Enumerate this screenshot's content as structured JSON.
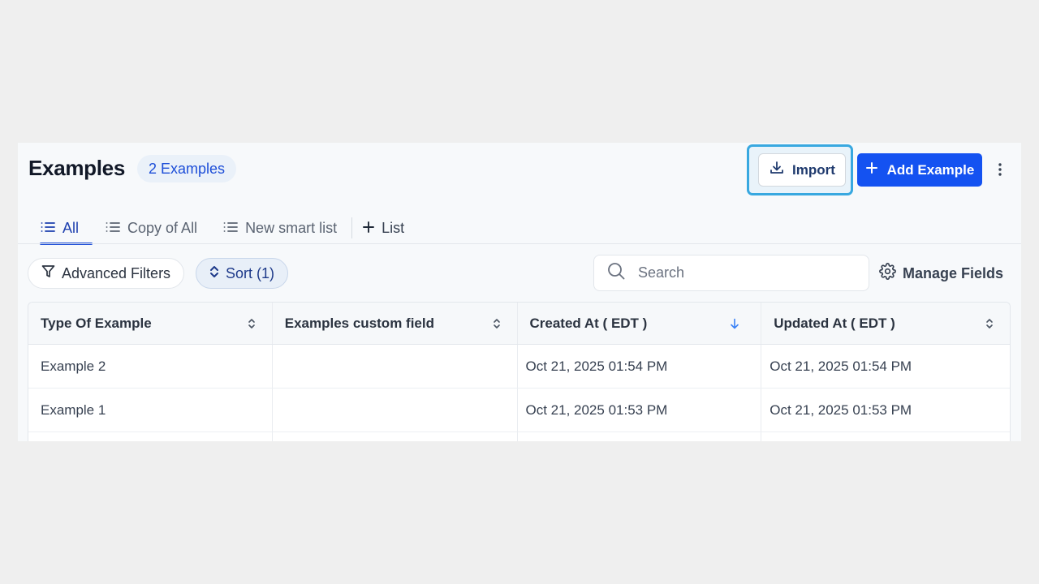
{
  "header": {
    "title": "Examples",
    "count_badge": "2 Examples",
    "import_label": "Import",
    "add_label": "Add Example"
  },
  "tabs": [
    {
      "label": "All",
      "active": true,
      "icon": "list-icon"
    },
    {
      "label": "Copy of All",
      "active": false,
      "icon": "list-icon"
    },
    {
      "label": "New smart list",
      "active": false,
      "icon": "list-icon"
    },
    {
      "label": "List",
      "active": false,
      "icon": "plus-icon"
    }
  ],
  "toolbar": {
    "filters_label": "Advanced Filters",
    "sort_label": "Sort (1)",
    "search_placeholder": "Search",
    "manage_fields_label": "Manage Fields"
  },
  "table": {
    "columns": [
      "Type Of Example",
      "Examples custom field",
      "Created At ( EDT )",
      "Updated At ( EDT )"
    ],
    "rows": [
      [
        "Example 2",
        "",
        "Oct 21, 2025 01:54 PM",
        "Oct 21, 2025 01:54 PM"
      ],
      [
        "Example 1",
        "",
        "Oct 21, 2025 01:53 PM",
        "Oct 21, 2025 01:53 PM"
      ]
    ]
  },
  "colors": {
    "primary": "#1452f1",
    "focus_ring": "#38a8e0",
    "active_tab": "#1d4ed8"
  }
}
